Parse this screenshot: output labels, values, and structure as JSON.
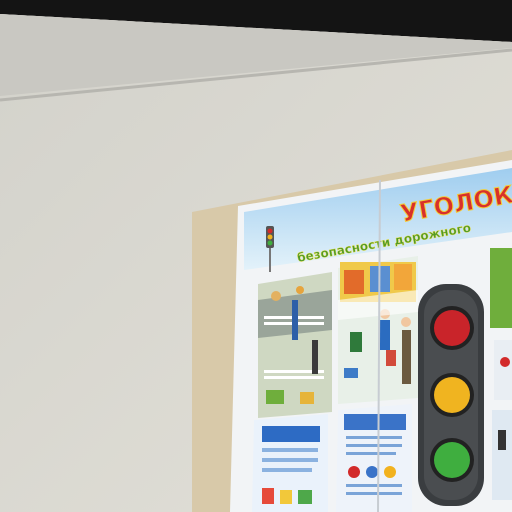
{
  "scene": {
    "kind": "photo of wall-mounted poster",
    "colors": {
      "wall": "#dcdad2",
      "ceiling_dark": "#1a1a1a",
      "frame_wood": "#d9c9a8",
      "poster_sky": "#bfe1f5",
      "poster_white": "#f4f6f8",
      "title_red": "#d8302a",
      "title_yellow": "#f2cf3a",
      "subtitle_green": "#5aa02c",
      "traffic_light_body": "#3a3d40",
      "light_red": "#d22a2a",
      "light_yellow": "#f2b21e",
      "light_green": "#3fae3f"
    }
  },
  "poster": {
    "title": "УГОЛОК",
    "subtitle": "безопасности дорожного"
  },
  "icons": [
    "traffic-light-icon",
    "zebra-crossing-icon",
    "pedestrian-icon"
  ]
}
